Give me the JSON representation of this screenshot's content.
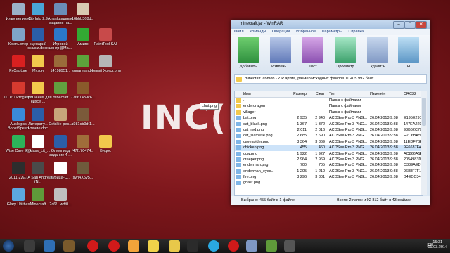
{
  "desktop": {
    "brand_logo_text": "INC(RE",
    "tooltip": "chat.png",
    "icons": [
      {
        "label": "Илья великий",
        "color": "#9bb1c8"
      },
      {
        "label": "CityInfo 2.9",
        "color": "#49a4d6"
      },
      {
        "label": "Алкайдашные задании па...",
        "color": "#6b8db8"
      },
      {
        "label": "16bbb368d...",
        "color": "#d9c9b1"
      },
      {
        "label": "Компьютер",
        "color": "#7fa4c8"
      },
      {
        "label": "сценарий сказки.docx",
        "color": "#2b5ea8"
      },
      {
        "label": "Игровой центр@Ma...",
        "color": "#2c77c9"
      },
      {
        "label": "Амиго",
        "color": "#33aa33"
      },
      {
        "label": "PaintTool SAI",
        "color": "#c84a4a"
      },
      {
        "label": "FxCapture",
        "color": "#d92020"
      },
      {
        "label": "Музон",
        "color": "#f2c94c"
      },
      {
        "label": "14198951...",
        "color": "#9a6b3a"
      },
      {
        "label": "squareland...",
        "color": "#5da33b"
      },
      {
        "label": "Новый Холст.png",
        "color": "#b6b6b6"
      },
      {
        "label": "TC PU Programs",
        "color": "#d63a2f"
      },
      {
        "label": "Украшения для нихсе ...",
        "color": "#f2c94c"
      },
      {
        "label": "minecraft",
        "color": "#62a03f"
      },
      {
        "label": "77661439c6...",
        "color": "#8a5a2b"
      },
      {
        "label": "Auslogics BoostSpeed",
        "color": "#3a8ad9"
      },
      {
        "label": "Литерату... чтение.doc",
        "color": "#2b5ea8"
      },
      {
        "label": "Detskie-pes...",
        "color": "#c7a67a"
      },
      {
        "label": "a981cb9df1...",
        "color": "#7b5a3a"
      },
      {
        "label": "Wise Care 365",
        "color": "#2db35a"
      },
      {
        "label": "4_klass_Lit_...",
        "color": "#ffffff"
      },
      {
        "label": "Олимпиад задание 4 ...",
        "color": "#2b5ea8"
      },
      {
        "label": "f47f170474...",
        "color": "#a06d3a"
      },
      {
        "label": "Видос",
        "color": "#f2c94c"
      },
      {
        "label": "2011-22-...",
        "color": "#2d2d2d"
      },
      {
        "label": "GTA San Andreas (N...",
        "color": "#4a4a4a"
      },
      {
        "label": "Курица-О...",
        "color": "#ffffff"
      },
      {
        "label": "svn4X5y5...",
        "color": "#6f5a3c"
      },
      {
        "label": "Glary Utilities",
        "color": "#5ca7e0"
      },
      {
        "label": "Minecraft",
        "color": "#5f9a3a"
      },
      {
        "label": "2c6f...wdt0...",
        "color": "#bfbfbf"
      }
    ]
  },
  "winrar": {
    "title": "minecraft.jar - WinRAR",
    "menu": [
      "Файл",
      "Команды",
      "Операции",
      "Избранное",
      "Параметры",
      "Справка"
    ],
    "tools": [
      "Добавить",
      "Извлечь...",
      "Тест",
      "Просмотр",
      "Удалить",
      "Н"
    ],
    "path": "minecraft.jar\\mob - ZIP архив, размер исходных файлов 10 405 992 байт",
    "columns": [
      "Имя",
      "Размер",
      "Сжат",
      "Тип",
      "Изменён",
      "CRC32"
    ],
    "rows": [
      [
        "..",
        "",
        "",
        "Папка с файлами",
        "",
        ""
      ],
      [
        "enderdragon",
        "",
        "",
        "Папка с файлами",
        "",
        ""
      ],
      [
        "villager",
        "",
        "",
        "Папка с файлами",
        "",
        ""
      ],
      [
        "bat.png",
        "2 935",
        "2 940",
        "ACDSee Pro 3 PNG...",
        "26.04.2013 9:38",
        "E195E29D"
      ],
      [
        "cat_black.png",
        "1 367",
        "1 372",
        "ACDSee Pro 3 PNG...",
        "26.04.2013 9:38",
        "147EA229"
      ],
      [
        "cat_red.png",
        "2 011",
        "2 016",
        "ACDSee Pro 3 PNG...",
        "26.04.2013 9:38",
        "93B62C79"
      ],
      [
        "cat_siamese.png",
        "2 685",
        "2 690",
        "ACDSee Pro 3 PNG...",
        "26.04.2013 9:38",
        "E2C6BA5D"
      ],
      [
        "cavespider.png",
        "3 364",
        "3 369",
        "ACDSee Pro 3 PNG...",
        "26.04.2013 9:38",
        "11EDF7BE"
      ],
      [
        "chicken.png",
        "455",
        "460",
        "ACDSee Pro 3 PNG...",
        "26.04.2013 9:38",
        "9F6637FA"
      ],
      [
        "cow.png",
        "1 922",
        "1 927",
        "ACDSee Pro 3 PNG...",
        "26.04.2013 9:38",
        "AC866A1E"
      ],
      [
        "creeper.png",
        "2 964",
        "2 969",
        "ACDSee Pro 3 PNG...",
        "26.04.2013 9:38",
        "2054983D"
      ],
      [
        "enderman.png",
        "700",
        "705",
        "ACDSee Pro 3 PNG...",
        "26.04.2013 9:38",
        "C339AED7"
      ],
      [
        "enderman_eyes...",
        "1 205",
        "1 210",
        "ACDSee Pro 3 PNG...",
        "26.04.2013 9:38",
        "9688F7F1"
      ],
      [
        "fire.png",
        "3 296",
        "3 301",
        "ACDSee Pro 3 PNG...",
        "26.04.2013 9:38",
        "B4ECC346"
      ],
      [
        "ghast.png",
        "",
        "",
        "",
        "",
        ""
      ]
    ],
    "selected_index": 8,
    "status_left": "Выбрано: 455 байт в 1 файле",
    "status_right": "Всего: 2 папок и 92 812 байт в 43 файлах"
  },
  "tray": {
    "lang": "EN",
    "time": "15:31",
    "date": "09.03.2014"
  }
}
